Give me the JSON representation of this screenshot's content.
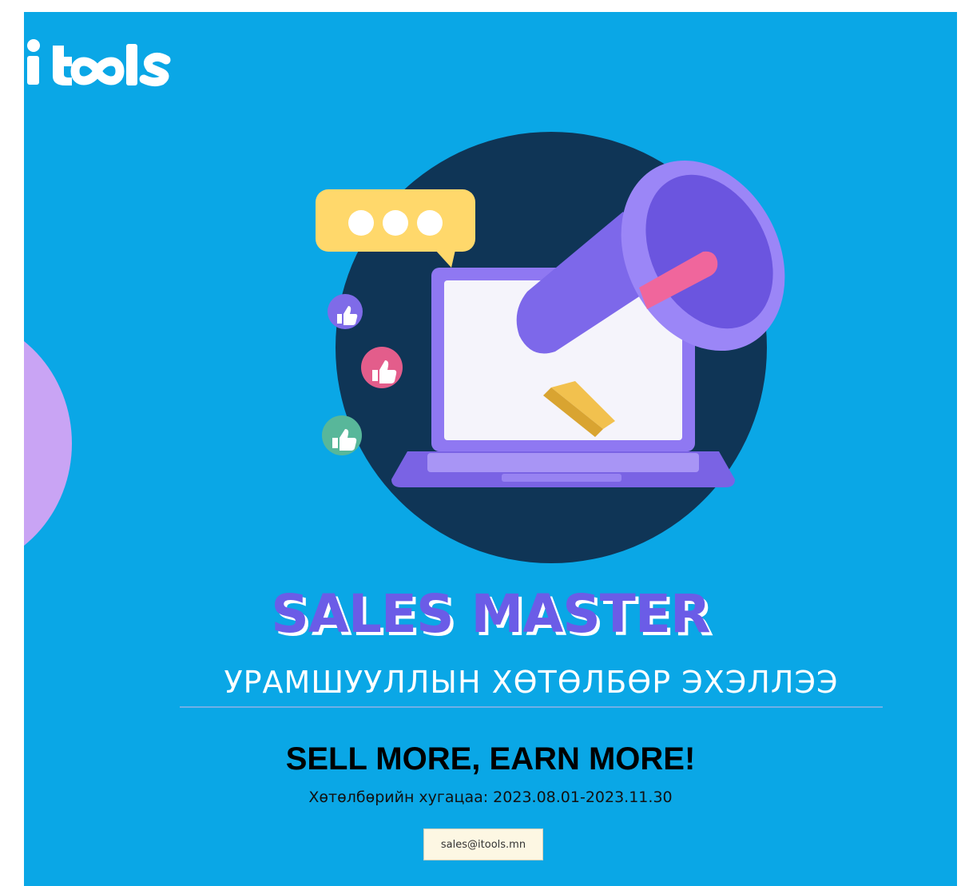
{
  "brand": {
    "logo_text": "itools"
  },
  "headline": "SALES MASTER",
  "subheadline": "УРАМШУУЛЛЫН ХӨТӨЛБӨР ЭХЭЛЛЭЭ",
  "slogan": "SELL MORE, EARN MORE!",
  "program_period": "Хөтөлбөрийн хугацаа: 2023.08.01-2023.11.30",
  "contact": {
    "email": "sales@itools.mn"
  },
  "illustration": {
    "icons": [
      "megaphone-icon",
      "laptop-icon",
      "chat-bubble-icon",
      "thumbs-up-icon",
      "thumbs-up-icon",
      "thumbs-up-icon"
    ]
  },
  "colors": {
    "background": "#0aa7e6",
    "circle": "#0f3556",
    "headline": "#6b5ce7",
    "accent_purple": "#8f78f2",
    "accent_pink": "#ea5c8d",
    "accent_yellow": "#ffd86b",
    "side_blob": "#c9a4f4"
  }
}
